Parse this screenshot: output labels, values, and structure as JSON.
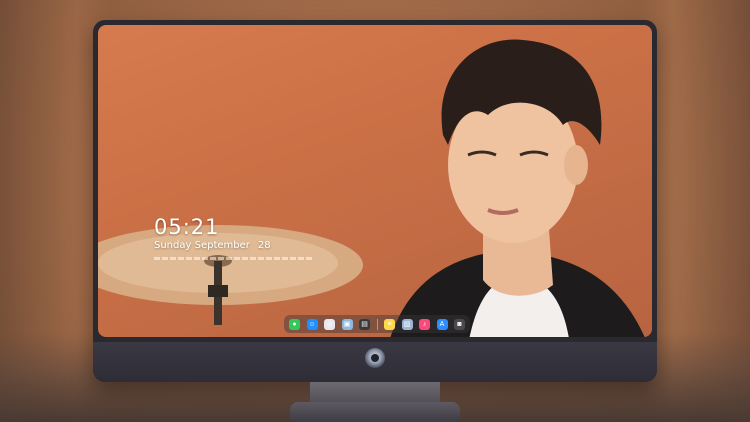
{
  "lock_screen": {
    "time": "05:21",
    "weekday_month": "Sunday September",
    "day": "28"
  },
  "dock": {
    "icons": [
      {
        "name": "messages-icon",
        "color": "#34c759",
        "glyph": "●"
      },
      {
        "name": "finder-icon",
        "color": "#1e90ff",
        "glyph": "☺"
      },
      {
        "name": "safari-icon",
        "color": "#e8e8ec",
        "glyph": "◎"
      },
      {
        "name": "preview-icon",
        "color": "#8fb9e0",
        "glyph": "▣"
      },
      {
        "name": "clapper-icon",
        "color": "#3a3a3c",
        "glyph": "▤"
      },
      {
        "name": "notes-icon",
        "color": "#ffd84a",
        "glyph": "≡"
      },
      {
        "name": "photos-icon",
        "color": "#9ab5d6",
        "glyph": "▨"
      },
      {
        "name": "music-icon",
        "color": "#fa4a7c",
        "glyph": "♪"
      },
      {
        "name": "app-store-icon",
        "color": "#2d8cff",
        "glyph": "A"
      },
      {
        "name": "camera-icon",
        "color": "#4a4a4e",
        "glyph": "◙"
      }
    ]
  },
  "colors": {
    "wallpaper": "#cb7046",
    "bezel": "#2b2930"
  }
}
